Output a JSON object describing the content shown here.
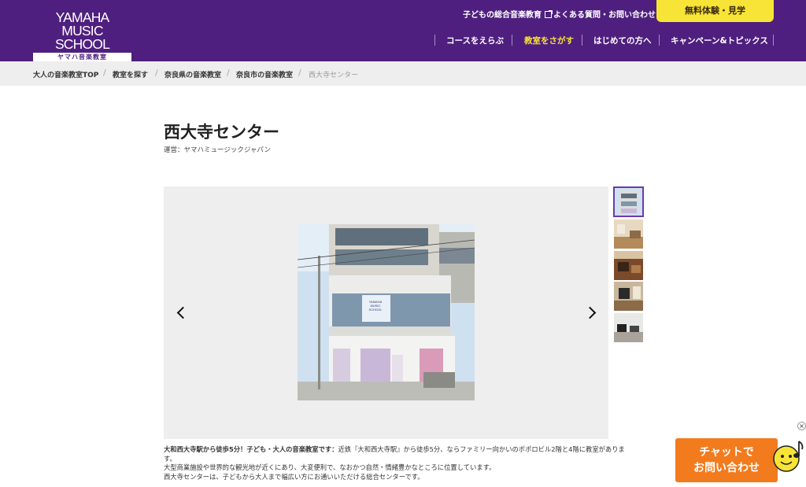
{
  "header": {
    "logo_line1": "YAMAHA",
    "logo_line2": "MUSIC SCHOOL",
    "logo_sub": "ヤマハ音楽教室",
    "util_links": [
      "子どもの総合音楽教育",
      "よくある質問・お問い合わせ"
    ],
    "trial_button": "無料体験・見学",
    "nav": [
      "コースをえらぶ",
      "教室をさがす",
      "はじめての方へ",
      "キャンペーン&トピックス"
    ],
    "brand_color": "#4f1f7f",
    "accent_color": "#f8e436"
  },
  "breadcrumb": [
    "大人の音楽教室TOP",
    "教室を探す",
    "奈良県の音楽教室",
    "奈良市の音楽教室",
    "西大寺センター"
  ],
  "page": {
    "title": "西大寺センター",
    "operator": "運営：ヤマハミュージックジャパン"
  },
  "gallery": {
    "sign_line1": "YAMAHA",
    "sign_line2": "MUSIC SCHOOL",
    "thumbnail_count": 5,
    "active_index": 0
  },
  "description": {
    "lead": "大和西大寺駅から徒歩5分！子ども・大人の音楽教室です：",
    "text1": "近鉄『大和西大寺駅』から徒歩5分、ならファミリー向かいのポポロビル2階と4階に教室があります。",
    "text2": "大型商業施設や世界的な観光地が近くにあり、大変便利で、なおかつ自然・情緒豊かなところに位置しています。",
    "text3": "西大寺センターは、子どもから大人まで幅広い方にお通いいただける総合センターです。"
  },
  "chat": {
    "line1": "チャットで",
    "line2": "お問い合わせ",
    "close": "×",
    "color": "#f27b1e"
  }
}
